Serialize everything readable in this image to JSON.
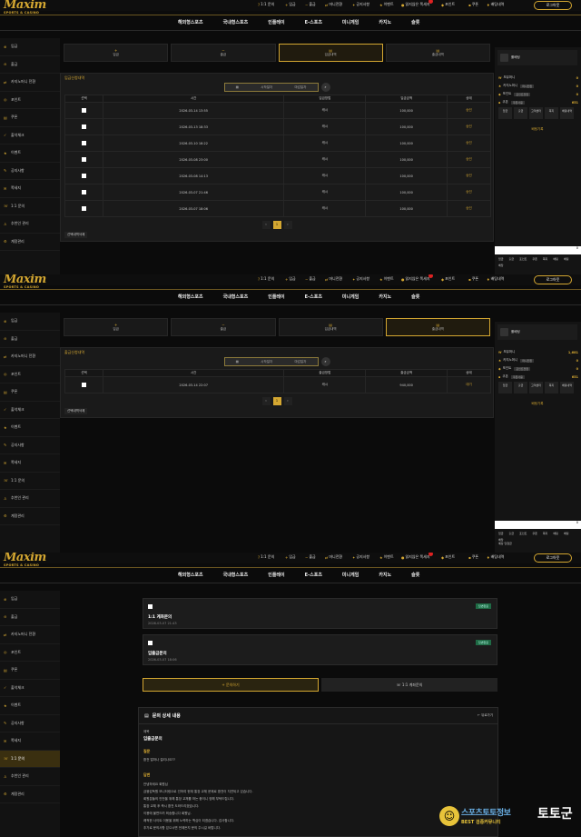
{
  "brand": {
    "name": "Maxim",
    "tagline": "SPORTS & CASINO"
  },
  "toplinks": [
    {
      "icon": "?",
      "label": "1:1 문의"
    },
    {
      "icon": "+",
      "label": "입금"
    },
    {
      "icon": "−",
      "label": "출금"
    },
    {
      "icon": "⇄",
      "label": "머니전환"
    },
    {
      "icon": "✦",
      "label": "공지사항"
    },
    {
      "icon": "★",
      "label": "이벤트"
    },
    {
      "icon": "●",
      "label": "읽지않은 쪽세지"
    },
    {
      "icon": "◆",
      "label": "포인트"
    },
    {
      "icon": "▪",
      "label": "쿠폰"
    },
    {
      "icon": "♦",
      "label": "배팅내역"
    }
  ],
  "login_label": "로그아웃",
  "nav": [
    "해외형스포츠",
    "국내형스포츠",
    "인플레이",
    "E-스포츠",
    "미니게임",
    "카지노",
    "슬롯"
  ],
  "sidebar": [
    {
      "icon": "⊕",
      "label": "입금"
    },
    {
      "icon": "⊖",
      "label": "출금"
    },
    {
      "icon": "⇄",
      "label": "카지노머니 전환"
    },
    {
      "icon": "◎",
      "label": "포인트"
    },
    {
      "icon": "▤",
      "label": "쿠폰"
    },
    {
      "icon": "✓",
      "label": "출석체크"
    },
    {
      "icon": "★",
      "label": "이벤트"
    },
    {
      "icon": "✎",
      "label": "공지사항"
    },
    {
      "icon": "✉",
      "label": "쪽세지"
    },
    {
      "icon": "☏",
      "label": "1:1 문의"
    },
    {
      "icon": "♙",
      "label": "추천인 관리"
    },
    {
      "icon": "⚙",
      "label": "계정관리"
    }
  ],
  "tabs": [
    {
      "icon": "+",
      "label": "입금"
    },
    {
      "icon": "−",
      "label": "출금"
    },
    {
      "icon": "▤",
      "label": "입금내역"
    },
    {
      "icon": "▤",
      "label": "출금내역"
    }
  ],
  "deposit": {
    "title": "입금신청내역",
    "start_placeholder": "시작일자",
    "end_placeholder": "마감일자",
    "columns": [
      "선택",
      "시간",
      "입금방법",
      "입금금액",
      "상태"
    ],
    "rows": [
      [
        "2026-03-14 13:55",
        "캐시",
        "100,000",
        "승인"
      ],
      [
        "2026-03-13 18:33",
        "캐시",
        "100,000",
        "승인"
      ],
      [
        "2026-03-10 18:22",
        "캐시",
        "100,000",
        "승인"
      ],
      [
        "2026-03-08 23:00",
        "캐시",
        "100,000",
        "승인"
      ],
      [
        "2026-03-08 14:13",
        "캐시",
        "100,000",
        "승인"
      ],
      [
        "2026-03-07 21:46",
        "캐시",
        "100,000",
        "승인"
      ],
      [
        "2026-03-07 18:06",
        "캐시",
        "100,000",
        "승인"
      ]
    ],
    "page": "1",
    "delete_label": "선택내역삭제"
  },
  "withdraw": {
    "title": "출금신청내역",
    "start_placeholder": "시작일자",
    "end_placeholder": "마감일자",
    "columns": [
      "선택",
      "시간",
      "출금방법",
      "출금금액",
      "상태"
    ],
    "rows": [
      [
        "2026-03-14 22:07",
        "캐시",
        "940,000",
        "대기"
      ]
    ],
    "page": "1",
    "delete_label": "선택내역삭제"
  },
  "right": {
    "user": "롤베팅",
    "rows1": [
      {
        "icon": "₩",
        "label": "보유머니",
        "v": "0"
      },
      {
        "icon": "♠",
        "label": "카지노머니",
        "tag": "머니전환",
        "v": "0"
      },
      {
        "icon": "◆",
        "label": "포인트",
        "tag": "포인트전환",
        "v": "0"
      },
      {
        "icon": "▪",
        "label": "쿠폰",
        "tag": "쿠폰사용",
        "v": "651"
      }
    ],
    "rows2": [
      {
        "icon": "₩",
        "label": "보유머니",
        "v": "1,681"
      },
      {
        "icon": "♠",
        "label": "카지노머니",
        "tag": "머니전환",
        "v": "0"
      },
      {
        "icon": "◆",
        "label": "포인트",
        "tag": "포인트전환",
        "v": "0"
      },
      {
        "icon": "▪",
        "label": "쿠폰",
        "tag": "쿠폰사용",
        "v": "651"
      }
    ],
    "grid": [
      "입금",
      "출금",
      "고객센터",
      "쪽지",
      "배팅내역"
    ],
    "link": "배팅기록",
    "calc": "0",
    "foot": [
      "입금",
      "출금",
      "포인트",
      "쿠폰",
      "쪽지",
      "배팅",
      "배팅"
    ],
    "foot_label": "배당",
    "foot_label2": "예상 당첨금"
  },
  "inquiry": {
    "items": [
      {
        "badge": "답변완료",
        "title": "1:1 계좌문의",
        "date": "2026-03-07 21:43"
      },
      {
        "badge": "답변완료",
        "title": "입출금문의",
        "date": "2026-03-07 18:06"
      }
    ],
    "write_label": "+ 문의하기",
    "account_label": "☏ 1:1 계좌문의",
    "detail_title": "문의 상세 내용",
    "back_label": "← 뒤로가기",
    "subject_label": "제목",
    "subject": "입출금문의",
    "question_label": "질문",
    "question": "환전 얼마나 걸리나요??",
    "answer_label": "답변",
    "answer_lines": [
      "안녕하세요 회원님",
      "금융감독원 모니터링으로 인하여 현재 통장 교체 문제로 환전이 지연되고 있습니다.",
      "회원분들의 안전을 위해 통장 교체를 하는 중이니 양해 부탁드립니다.",
      "통장 교체 후 즉시 환전 도와드리겠습니다.",
      "이용에 불편드려 죄송합니다 회원님.",
      "쾌적한 사이트 이용을 위해 노력하는 맥심이 되겠습니다. 감사합니다.",
      "추가로 문의사항 있으시면 언제든지 문의 주시길 바랍니다."
    ]
  },
  "watermark": {
    "line1": "스포츠토토정보",
    "line2": "BEST 검증커뮤니티",
    "line3": "토토군"
  }
}
